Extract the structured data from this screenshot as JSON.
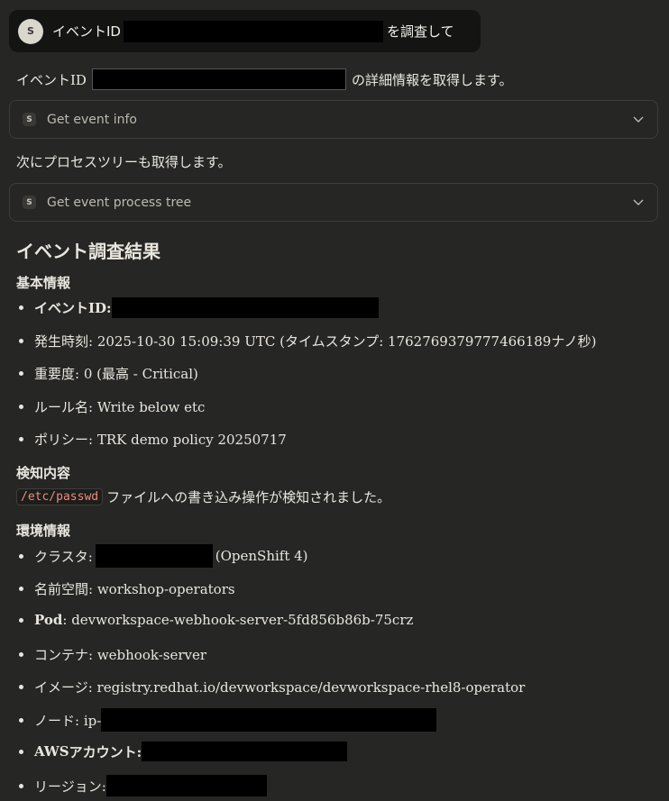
{
  "user_message": {
    "avatar_initial": "S",
    "prefix": "イベントID",
    "suffix": "を調査して"
  },
  "assistant": {
    "intro_prefix": "イベントID",
    "intro_suffix": "の詳細情報を取得します。",
    "tool1_icon": "S",
    "tool1_label": "Get event info",
    "between_text": "次にプロセスツリーも取得します。",
    "tool2_icon": "S",
    "tool2_label": "Get event process tree",
    "heading": "イベント調査結果",
    "basic": {
      "title": "基本情報",
      "event_id_label": "イベントID:",
      "time": "発生時刻: 2025-10-30 15:09:39 UTC (タイムスタンプ: 1762769379777466189ナノ秒)",
      "severity": "重要度: 0 (最高 - Critical)",
      "rule": "ルール名: Write below etc",
      "policy": "ポリシー: TRK demo policy 20250717"
    },
    "detection": {
      "title": "検知内容",
      "code": "/etc/passwd",
      "text": "ファイルへの書き込み操作が検知されました。"
    },
    "environment": {
      "title": "環境情報",
      "cluster_label": "クラスタ:",
      "cluster_suffix": "(OpenShift 4)",
      "namespace": "名前空間: workshop-operators",
      "pod_label": "Pod",
      "pod_value": ": devworkspace-webhook-server-5fd856b86b-75crz",
      "container": "コンテナ: webhook-server",
      "image": "イメージ: registry.redhat.io/devworkspace/devworkspace-rhel8-operator",
      "node_label": "ノード: ip-",
      "aws_label_bold": "AWS",
      "aws_label_rest": "アカウント:",
      "region_label": "リージョン:"
    }
  },
  "icons": [
    "chevron-down-icon"
  ]
}
